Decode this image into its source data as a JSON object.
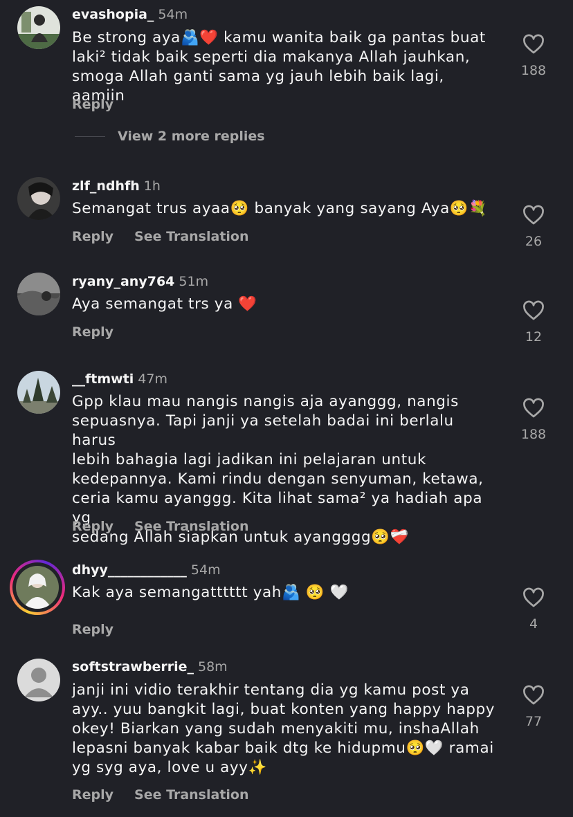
{
  "comments": [
    {
      "username": "evashopia_",
      "time": "54m",
      "text": "Be strong aya🫂❤️ kamu wanita baik ga pantas buat\nlaki² tidak baik seperti dia makanya Allah jauhkan,\nsmoga Allah ganti sama yg jauh lebih baik lagi, aamiin",
      "reply": "Reply",
      "translate": "",
      "likes": "188",
      "view_replies": "View 2 more replies"
    },
    {
      "username": "zlf_ndhfh",
      "time": "1h",
      "text": "Semangat trus ayaa🥺 banyak yang sayang Aya🥺💐",
      "reply": "Reply",
      "translate": "See Translation",
      "likes": "26"
    },
    {
      "username": "ryany_any764",
      "time": "51m",
      "text": "Aya semangat trs ya ❤️",
      "reply": "Reply",
      "translate": "",
      "likes": "12"
    },
    {
      "username": "__ftmwti",
      "time": "47m",
      "text": "Gpp klau mau nangis nangis aja ayanggg, nangis\nsepuasnya. Tapi janji ya setelah badai ini berlalu harus\nlebih bahagia lagi jadikan ini pelajaran untuk\nkedepannya. Kami rindu dengan senyuman, ketawa,\nceria kamu ayanggg. Kita lihat sama² ya hadiah apa yg\nsedang Allah siapkan untuk ayangggg🥺❤️‍🩹",
      "reply": "Reply",
      "translate": "See Translation",
      "likes": "188"
    },
    {
      "username": "dhyy____________",
      "time": "54m",
      "text": "Kak aya semangatttttt yah🫂 🥺 🤍",
      "reply": "Reply",
      "translate": "",
      "likes": "4"
    },
    {
      "username": "softstrawberrie_",
      "time": "58m",
      "text": "janji ini vidio terakhir tentang dia yg kamu post ya\nayy.. yuu bangkit lagi, buat konten yang happy happy\nokey! Biarkan yang sudah menyakiti mu, inshaAllah\nlepasni banyak kabar baik dtg ke hidupmu🥺🤍 ramai\nyg syg aya, love u ayy✨",
      "reply": "Reply",
      "translate": "See Translation",
      "likes": "77"
    }
  ],
  "icons": {
    "like": "heart-outline-icon",
    "default_avatar": "default-avatar-icon"
  },
  "colors": {
    "background": "#202127",
    "text": "#f5f5f5",
    "muted": "#a8a8a8"
  }
}
